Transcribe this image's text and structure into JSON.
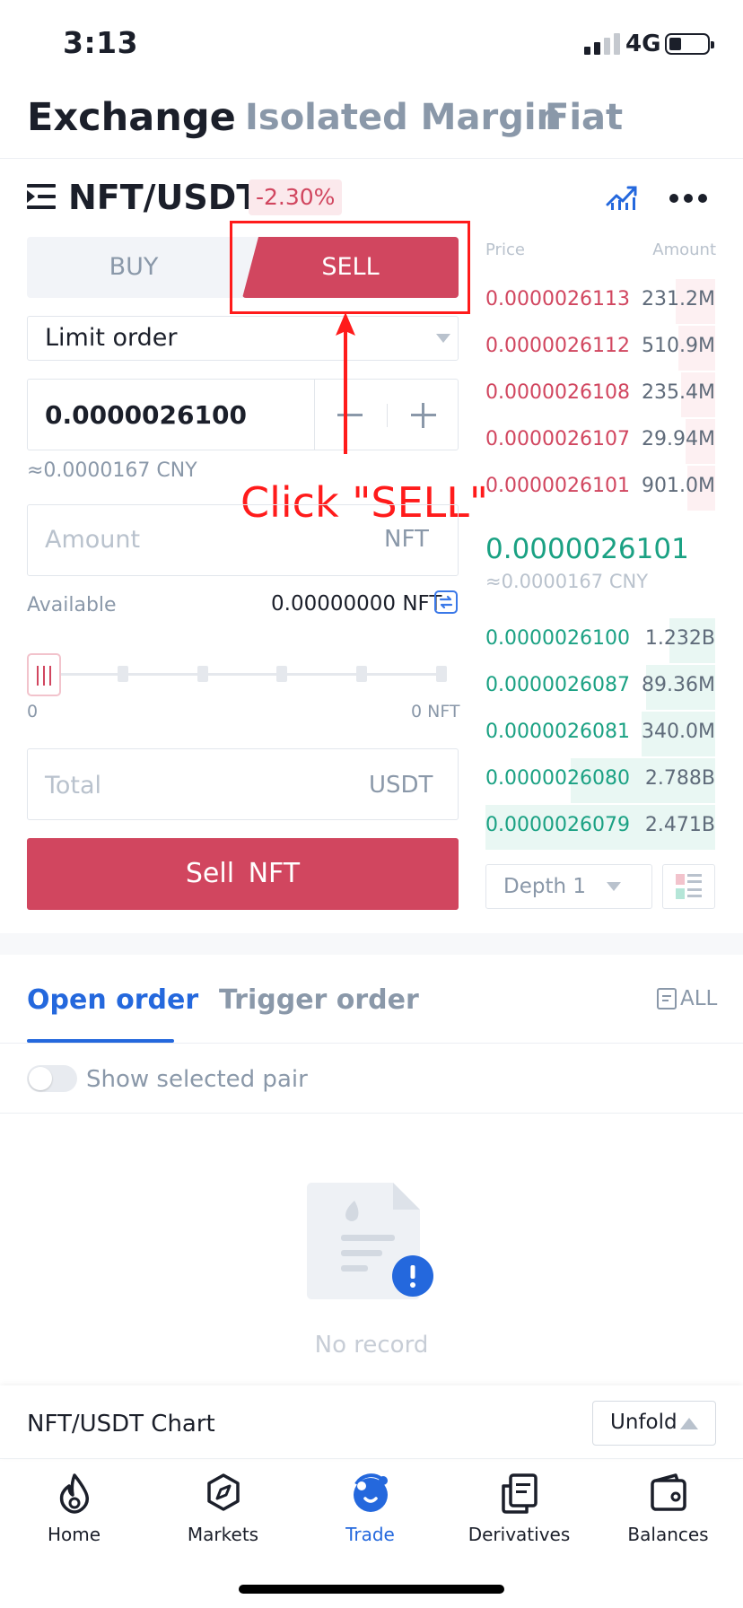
{
  "status_bar": {
    "time": "3:13",
    "network": "4G"
  },
  "top_tabs": [
    "Exchange",
    "Isolated Margin",
    "Fiat"
  ],
  "pair": {
    "name": "NFT/USDT",
    "change": "-2.30%"
  },
  "side_toggle": {
    "buy": "BUY",
    "sell": "SELL"
  },
  "order_form": {
    "order_type": "Limit order",
    "price_value": "0.0000026100",
    "price_cny": "≈0.0000167 CNY",
    "amount_placeholder": "Amount",
    "amount_unit": "NFT",
    "available_label": "Available",
    "available_value": "0.00000000 NFT",
    "slider_min": "0",
    "slider_max": "0 NFT",
    "slider_level": 0,
    "total_placeholder": "Total",
    "total_unit": "USDT",
    "submit_label": "Sell  NFT"
  },
  "annotation": {
    "text": "Click \"SELL\""
  },
  "order_book": {
    "price_header": "Price",
    "amount_header": "Amount",
    "asks": [
      {
        "price": "0.0000026113",
        "amount": "231.2M",
        "depth": 0.17
      },
      {
        "price": "0.0000026112",
        "amount": "510.9M",
        "depth": 0.16
      },
      {
        "price": "0.0000026108",
        "amount": "235.4M",
        "depth": 0.15
      },
      {
        "price": "0.0000026107",
        "amount": "29.94M",
        "depth": 0.13
      },
      {
        "price": "0.0000026101",
        "amount": "901.0M",
        "depth": 0.12
      }
    ],
    "last_price": "0.0000026101",
    "last_price_cny": "≈0.0000167 CNY",
    "bids": [
      {
        "price": "0.0000026100",
        "amount": "1.232B",
        "depth": 0.2
      },
      {
        "price": "0.0000026087",
        "amount": "89.36M",
        "depth": 0.3
      },
      {
        "price": "0.0000026081",
        "amount": "340.0M",
        "depth": 0.32
      },
      {
        "price": "0.0000026080",
        "amount": "2.788B",
        "depth": 0.63
      },
      {
        "price": "0.0000026079",
        "amount": "2.471B",
        "depth": 1.0
      }
    ],
    "depth_select": "Depth 1"
  },
  "orders": {
    "tabs": [
      "Open order",
      "Trigger order"
    ],
    "all_label": "ALL",
    "show_selected_pair": "Show selected pair",
    "empty_text": "No record"
  },
  "chart_bar": {
    "title": "NFT/USDT Chart",
    "unfold_label": "Unfold"
  },
  "bottom_nav": [
    "Home",
    "Markets",
    "Trade",
    "Derivatives",
    "Balances"
  ],
  "colors": {
    "sell": "#d1465f",
    "buy": "#1aa183",
    "accent": "#2468dd",
    "annotation": "#ff1b1b"
  }
}
